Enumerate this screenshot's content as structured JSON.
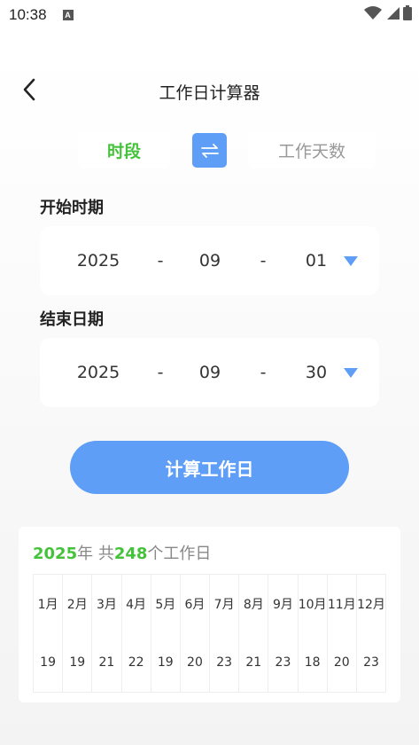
{
  "status_bar": {
    "time": "10:38",
    "a_icon": "A"
  },
  "header": {
    "title": "工作日计算器"
  },
  "mode_switch": {
    "active_tab": "时段",
    "inactive_tab": "工作天数"
  },
  "start_date": {
    "label": "开始时期",
    "year": "2025",
    "sep1": "-",
    "month": "09",
    "sep2": "-",
    "day": "01"
  },
  "end_date": {
    "label": "结束日期",
    "year": "2025",
    "sep1": "-",
    "month": "09",
    "sep2": "-",
    "day": "30"
  },
  "calculate_button": {
    "label": "计算工作日"
  },
  "result": {
    "year": "2025",
    "year_suffix": "年 共",
    "total": "248",
    "total_suffix": "个工作日",
    "months": [
      {
        "month": "1月",
        "days": "19"
      },
      {
        "month": "2月",
        "days": "19"
      },
      {
        "month": "3月",
        "days": "21"
      },
      {
        "month": "4月",
        "days": "22"
      },
      {
        "month": "5月",
        "days": "19"
      },
      {
        "month": "6月",
        "days": "20"
      },
      {
        "month": "7月",
        "days": "23"
      },
      {
        "month": "8月",
        "days": "21"
      },
      {
        "month": "9月",
        "days": "23"
      },
      {
        "month": "10月",
        "days": "18"
      },
      {
        "month": "11月",
        "days": "20"
      },
      {
        "month": "12月",
        "days": "23"
      }
    ]
  },
  "colors": {
    "accent": "#5e9ef7",
    "green": "#44c23a"
  },
  "icons": {
    "back": "chevron-left-icon",
    "swap": "swap-arrows-icon",
    "dropdown": "triangle-down-icon"
  }
}
